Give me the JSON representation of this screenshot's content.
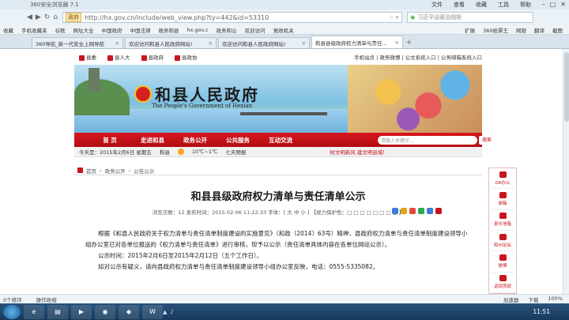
{
  "browser": {
    "title": "360安全浏览器 7.1",
    "menus": [
      "文件",
      "查看",
      "收藏",
      "工具",
      "帮助"
    ],
    "tag": "政府",
    "url": "http://hx.gov.cn/include/web_view.php?ty=442&id=53310",
    "search_placeholder": "习近平谈政治规矩",
    "favorites": [
      "收藏",
      "手机收藏夹",
      "谷歌",
      "网址大全",
      "中国政府",
      "中国法律",
      "政务和县",
      "hx.gov.c",
      "政务和公",
      "欢迎访问",
      "党政机关"
    ],
    "favorites_right": [
      "扩展",
      "360抢票王",
      "网银",
      "翻译",
      "截图"
    ],
    "tabs": [
      {
        "label": "360导航_新一代安全上网导航"
      },
      {
        "label": "欢迎访问和县人民政府网站!"
      },
      {
        "label": "欢迎访问和县人民政府网站!"
      },
      {
        "label": "和县县级政府权力清单与责任..."
      }
    ],
    "status_left": [
      "0个感评",
      "操作收缩"
    ],
    "status_right": [
      "加速器",
      "下载",
      "100%"
    ]
  },
  "site": {
    "top_links": [
      "县委",
      "县人大",
      "县政府",
      "县政协"
    ],
    "top_right": "手机站点 | 政务微博 | 公文系统入口 | 公务邮箱系统入口",
    "name": "和县人民政府",
    "name_en": "The People's Government of Hexian",
    "menu": [
      "首 页",
      "走进和县",
      "政务公开",
      "公共服务",
      "互动交流"
    ],
    "search_placeholder": "请输入关键字...",
    "search_button": "搜索",
    "today": "今天是：2015年2月6日 星期五",
    "weather_city": "和县",
    "weather_temp": "10℃~1℃",
    "weather_wind": "七天预报",
    "notice": "树文明新风  建文明县城!"
  },
  "breadcrumb": [
    "首页",
    "政务公开",
    "公告公示"
  ],
  "article": {
    "title": "和县县级政府权力清单与责任清单公示",
    "meta": "浏览次数：12   发布时间：2015-02-06 11:22:33   字体：[ 大 中 小 ]   【视力保护色：□ □ □ □ □ □ □ □ 】",
    "para1": "根据《和县人民政府关于权力清单与责任清单制度建设的实施意见》（和政〔2014〕63号）精神，县政府权力清单与责任清单制度建设领导小组办公室已对各单位报送的《权力清单与责任清单》进行审核，现予以公示（责任清单具体内容在各单位网站公示）。",
    "para2": "公示时间：2015年2月6日至2015年2月12日（五个工作日）。",
    "para3": "如对公示有疑义，请向县政府权力清单与责任清单制度建设领导小组办公室反映，电话：0555-5335082。"
  },
  "sidepanel": [
    "OA办公",
    "邮箱",
    "县长信箱",
    "和州论坛",
    "微博",
    "返回顶部"
  ],
  "taskbar": {
    "clock": "11:51"
  }
}
